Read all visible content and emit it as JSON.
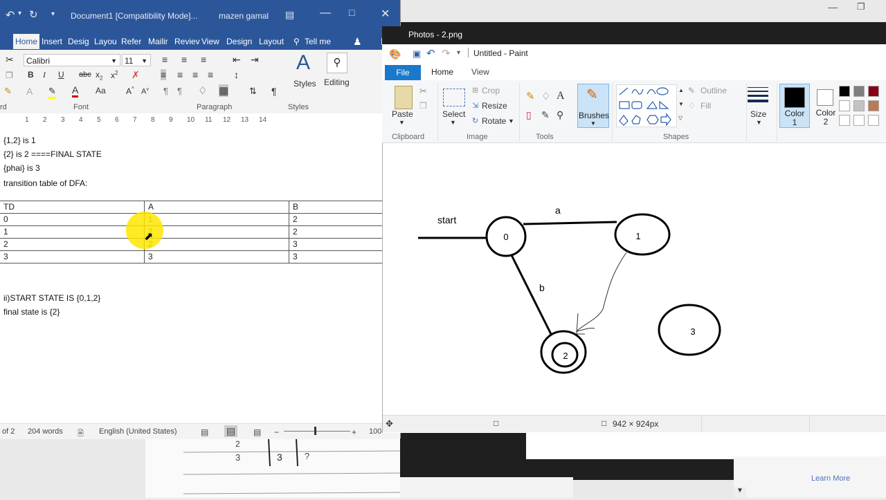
{
  "background": {
    "learn_more": "Learn More"
  },
  "word": {
    "title": "Document1 [Compatibility Mode]...",
    "user": "mazen gamal",
    "tabs": [
      "Home",
      "Insert",
      "Desig",
      "Layou",
      "Refer",
      "Mailir",
      "Reviev",
      "View",
      "Design",
      "Layout"
    ],
    "tell_me": "Tell me",
    "font_name": "Calibri",
    "font_size": "11",
    "groups": {
      "clipboard": "rd",
      "font": "Font",
      "paragraph": "Paragraph",
      "styles": "Styles"
    },
    "styles_label": "Styles",
    "editing_label": "Editing",
    "ruler_numbers": [
      "1",
      "2",
      "3",
      "4",
      "5",
      "6",
      "7",
      "8",
      "9",
      "10",
      "11",
      "12",
      "13",
      "14"
    ],
    "doc_lines": [
      "{1,2} is 1",
      "{2} is 2 ====FINAL STATE",
      "{phai} is 3",
      "transition table of DFA:",
      "ii)START STATE IS {0,1,2}",
      "final state is {2}"
    ],
    "table": {
      "headers": [
        "TD",
        "A",
        "B"
      ],
      "rows": [
        [
          "0",
          "1",
          "2"
        ],
        [
          "1",
          "2",
          "2"
        ],
        [
          "2",
          "2",
          "3"
        ],
        [
          "3",
          "3",
          "3"
        ]
      ]
    },
    "status": {
      "pages": "of 2",
      "words": "204 words",
      "language": "English (United States)",
      "zoom": "100"
    }
  },
  "photos": {
    "title": "Photos - 2.png"
  },
  "paint": {
    "title": "Untitled - Paint",
    "tabs": {
      "file": "File",
      "home": "Home",
      "view": "View"
    },
    "clipboard": {
      "paste": "Paste",
      "group": "Clipboard"
    },
    "image": {
      "select": "Select",
      "crop": "Crop",
      "resize": "Resize",
      "rotate": "Rotate",
      "group": "Image"
    },
    "tools_group": "Tools",
    "brushes": "Brushes",
    "shapes": {
      "outline": "Outline",
      "fill": "Fill",
      "group": "Shapes"
    },
    "size": "Size",
    "color1": "Color 1",
    "color2": "Color 2",
    "color1_value": "#000000",
    "color2_value": "#ffffff",
    "palette": [
      "#000000",
      "#7f7f7f",
      "#880015",
      "#ffffff",
      "#c3c3c3",
      "#b97a57",
      "#ffffff",
      "#ffffff",
      "#ffffff"
    ],
    "status_dims": "942 × 924px",
    "diagram": {
      "start_label": "start",
      "edge_a": "a",
      "edge_b": "b",
      "states": [
        "0",
        "1",
        "2",
        "3"
      ]
    }
  }
}
